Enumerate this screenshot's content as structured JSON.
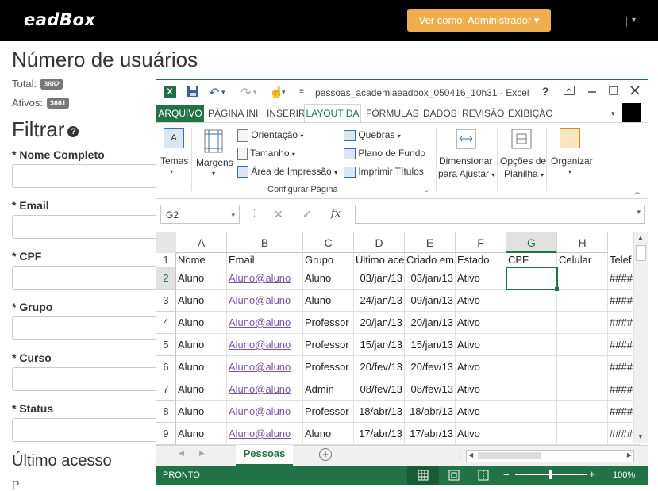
{
  "web": {
    "logo": "eadBox",
    "view_button": "Ver como: Administrador ▾",
    "nav_caret": "▾",
    "users_heading": "Número de usuários",
    "total_label": "Total:",
    "total_value": "3882",
    "active_label": "Ativos:",
    "active_value": "3661",
    "filter_heading": "Filtrar",
    "help_icon": "?",
    "fields": [
      "* Nome Completo",
      "* Email",
      "* CPF",
      "* Grupo",
      "* Curso",
      "* Status"
    ],
    "last_access_heading": "Último acesso",
    "tail_text": "P"
  },
  "excel": {
    "title": "pessoas_academiaeadbox_050416_10h31 - Excel",
    "help": "?",
    "tabs": [
      "ARQUIVO",
      "PÁGINA INI",
      "INSERIR",
      "LAYOUT DA",
      "FÓRMULAS",
      "DADOS",
      "REVISÃO",
      "EXIBIÇÃO"
    ],
    "ribbon": {
      "temas": "Temas",
      "margens": "Margens",
      "orientacao": "Orientação",
      "tamanho": "Tamanho",
      "area_impressao": "Área de Impressão",
      "quebras": "Quebras",
      "plano_fundo": "Plano de Fundo",
      "imprimir_titulos": "Imprimir Títulos",
      "dimensionar_1": "Dimensionar",
      "dimensionar_2": "para Ajustar",
      "opcoes_1": "Opções de",
      "opcoes_2": "Planilha",
      "organizar": "Organizar",
      "group_label": "Configurar Página"
    },
    "name_box": "G2",
    "fx": "fx",
    "columns": [
      "A",
      "B",
      "C",
      "D",
      "E",
      "F",
      "G",
      "H"
    ],
    "row_numbers": [
      "1",
      "2",
      "3",
      "4",
      "5",
      "6",
      "7",
      "8",
      "9"
    ],
    "header_row": [
      "Nome",
      "Email",
      "Grupo",
      "Último ace",
      "Criado em",
      "Estado",
      "CPF",
      "Celular",
      "Telef"
    ],
    "rows": [
      [
        "Aluno",
        "Aluno@aluno",
        "Aluno",
        "03/jan/13",
        "03/jan/13",
        "Ativo",
        "",
        "",
        "####"
      ],
      [
        "Aluno",
        "Aluno@aluno",
        "Aluno",
        "24/jan/13",
        "09/jan/13",
        "Ativo",
        "",
        "",
        "####"
      ],
      [
        "Aluno",
        "Aluno@aluno",
        "Professor",
        "20/jan/13",
        "20/jan/13",
        "Ativo",
        "",
        "",
        "####"
      ],
      [
        "Aluno",
        "Aluno@aluno",
        "Professor",
        "15/jan/13",
        "15/jan/13",
        "Ativo",
        "",
        "",
        "####"
      ],
      [
        "Aluno",
        "Aluno@aluno",
        "Professor",
        "20/fev/13",
        "20/fev/13",
        "Ativo",
        "",
        "",
        "####"
      ],
      [
        "Aluno",
        "Aluno@aluno",
        "Admin",
        "08/fev/13",
        "08/fev/13",
        "Ativo",
        "",
        "",
        "####"
      ],
      [
        "Aluno",
        "Aluno@aluno",
        "Professor",
        "18/abr/13",
        "18/abr/13",
        "Ativo",
        "",
        "",
        "####"
      ],
      [
        "Aluno",
        "Aluno@aluno",
        "Aluno",
        "17/abr/13",
        "17/abr/13",
        "Ativo",
        "",
        "",
        "####"
      ]
    ],
    "sheet_name": "Pessoas",
    "status_text": "PRONTO",
    "zoom": "100%"
  }
}
